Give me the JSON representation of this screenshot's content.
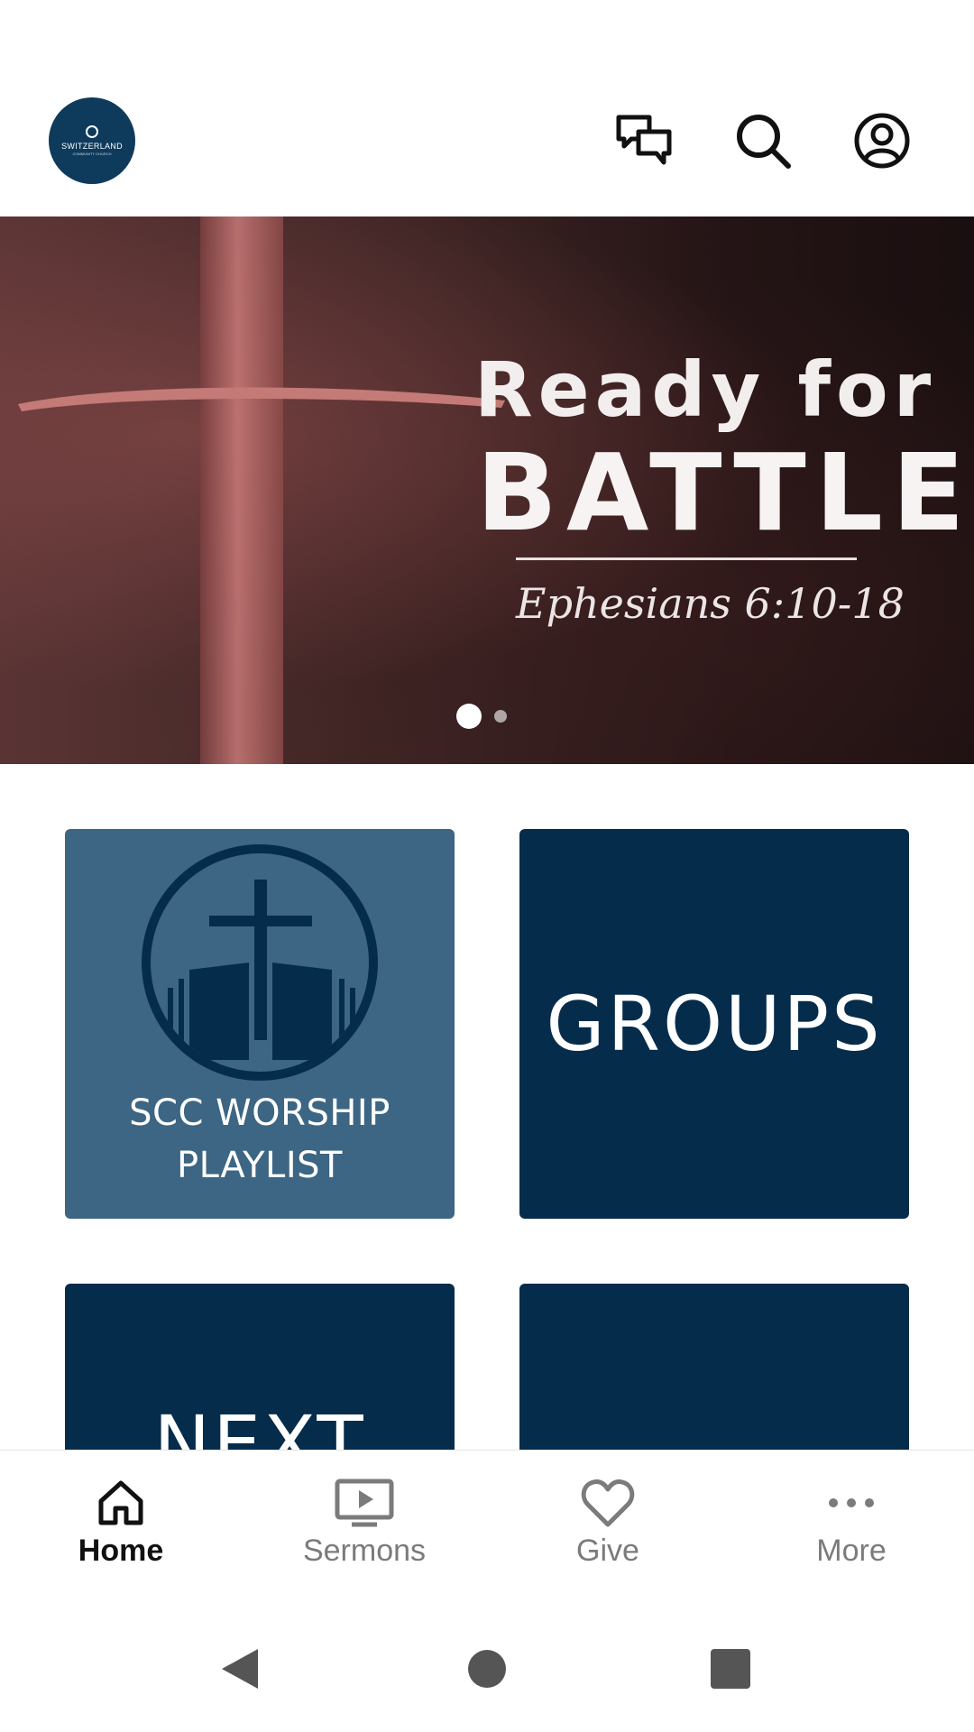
{
  "header": {
    "logo_text": "SWITZERLAND",
    "logo_subtext": "COMMUNITY CHURCH",
    "icons": [
      "chat-icon",
      "search-icon",
      "account-icon"
    ]
  },
  "banner": {
    "title_line1": "Ready for",
    "title_line2": "BATTLE",
    "subtitle": "Ephesians 6:10-18",
    "carousel": {
      "total": 2,
      "active": 1
    }
  },
  "tiles": [
    {
      "label_line1": "SCC WORSHIP",
      "label_line2": "PLAYLIST",
      "color": "#3c6683"
    },
    {
      "label": "GROUPS",
      "color": "#062c4c"
    },
    {
      "label": "NEXT",
      "color": "#062c4c"
    },
    {
      "label": "",
      "color": "#062c4c"
    }
  ],
  "bottom_nav": {
    "items": [
      {
        "label": "Home",
        "icon": "home-icon",
        "active": true
      },
      {
        "label": "Sermons",
        "icon": "tv-play-icon",
        "active": false
      },
      {
        "label": "Give",
        "icon": "heart-icon",
        "active": false
      },
      {
        "label": "More",
        "icon": "more-dots-icon",
        "active": false
      }
    ]
  },
  "system_nav": [
    "back-icon",
    "home-circle-icon",
    "recents-icon"
  ]
}
